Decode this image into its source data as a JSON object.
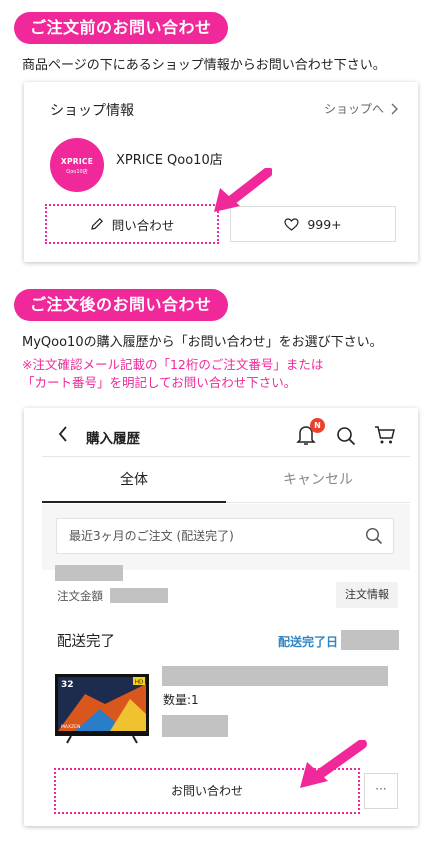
{
  "section1": {
    "heading": "ご注文前のお問い合わせ",
    "lead": "商品ページの下にあるショップ情報からお問い合わせ下さい。",
    "shop_card": {
      "title": "ショップ情報",
      "link_label": "ショップへ",
      "logo_text": "XPRICE",
      "logo_subtext": "Qoo10店",
      "shop_name": "XPRICE Qoo10店",
      "ask_button": "問い合わせ",
      "like_count": "999+"
    }
  },
  "section2": {
    "heading": "ご注文後のお問い合わせ",
    "lead": "MyQoo10の購入履歴から「お問い合わせ」をお選び下さい。",
    "note_line1": "※注文確認メール記載の「12桁のご注文番号」または",
    "note_line2": "「カート番号」を明記してお問い合わせ下さい。",
    "history": {
      "title": "購入履歴",
      "notification_badge": "N",
      "tabs": [
        "全体",
        "キャンセル"
      ],
      "search_placeholder": "最近3ヶ月のご注文 (配送完了)",
      "amount_label": "注文金額",
      "order_info_button": "注文情報",
      "status": "配送完了",
      "delivery_date_label": "配送完了日",
      "quantity": "数量:1",
      "product_tag_size": "32",
      "product_tag_hd": "HD",
      "product_brand": "MAXZEN",
      "contact_button": "お問い合わせ",
      "more_button": "···"
    }
  },
  "colors": {
    "accent": "#f0289a",
    "link_blue": "#2f86c4",
    "redacted": "#c2c2c2"
  }
}
